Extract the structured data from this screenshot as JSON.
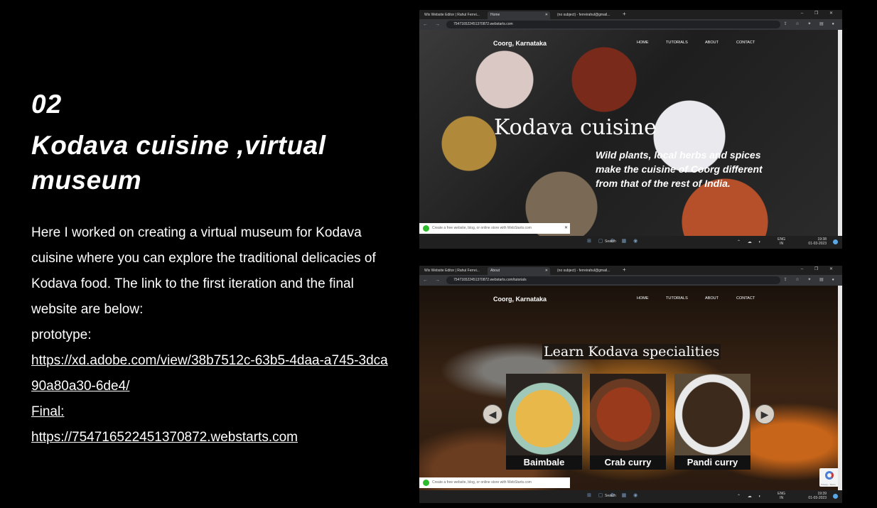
{
  "section": {
    "number": "02",
    "title": "Kodava cuisine ,virtual museum",
    "description": "Here I worked on creating a virtual museum for Kodava cuisine where you can explore the traditional delicacies of Kodava food. The link to the first iteration and the final website are below:",
    "prototype_label": "prototype:",
    "prototype_url": "https://xd.adobe.com/view/38b7512c-63b5-4daa-a745-3dca90a80a30-6de4/",
    "final_label": "Final:",
    "final_url": "https://754716522451370872.webstarts.com"
  },
  "browser": {
    "tab_wix": "Wix Website Editor | Rahul Ferrei...",
    "tab_gmail": "(no subject) - ferreirahul@gmail...",
    "new_tab": "+",
    "window_controls": "– ❐ ✕",
    "nav_buttons": "← → ↻",
    "ext_icons": "⇪ ☆ ✦ ▤ ●"
  },
  "site": {
    "logo": "Coorg, Karnataka",
    "nav": [
      "HOME",
      "TUTORIALS",
      "ABOUT",
      "CONTACT"
    ]
  },
  "shot1": {
    "tab_active": "Home",
    "url": "754716522451370872.webstarts.com",
    "hero_title": "Kodava cuisine",
    "hero_subtitle": "Wild plants, local herbs and spices make the cuisine of Coorg different from that of the rest of India.",
    "toast": "Create a free website, blog, or online store with WebStarts.com",
    "time": "19:38",
    "date": "01-03-2023"
  },
  "shot2": {
    "tab_active": "About",
    "url": "754716522451370872.webstarts.com/tutorials",
    "heading": "Learn Kodava specialities",
    "dishes": [
      "Baimbale",
      "Crab curry",
      "Pandi curry"
    ],
    "toast": "Create a free website, blog, or online store with WebStarts.com",
    "time": "19:39",
    "date": "01-03-2023"
  },
  "taskbar": {
    "search": "Search",
    "lang": "ENG",
    "region": "IN",
    "apps": "⊞ ▢ ⚙ ▦ ◉"
  },
  "recaptcha_label": "Privacy - Terms",
  "colors": {
    "background": "#000000",
    "text": "#ffffff",
    "toast_dot": "#2dbb2d",
    "taskbar": "#202020"
  }
}
